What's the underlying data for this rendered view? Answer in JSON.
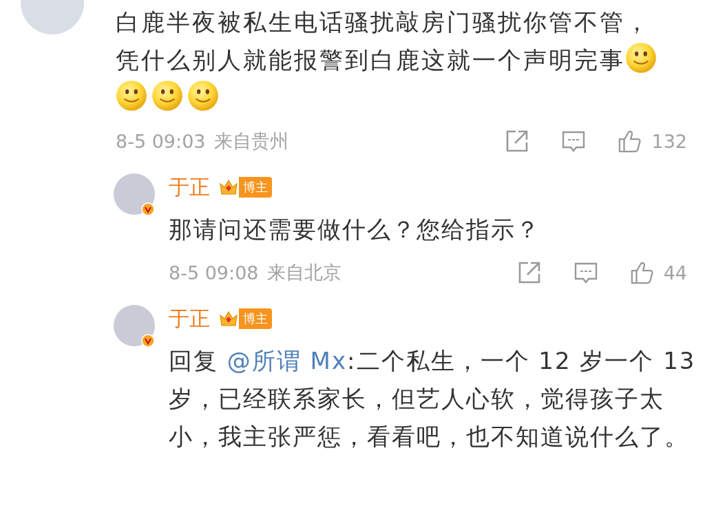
{
  "comments": [
    {
      "content": [
        {
          "kind": "text",
          "text": "白鹿半夜被私生电话骚扰敲房门骚扰你管不管，凭什么别人就能报警到白鹿这就一个声明完事"
        },
        {
          "kind": "emoji"
        },
        {
          "kind": "emoji"
        },
        {
          "kind": "emoji"
        },
        {
          "kind": "emoji"
        }
      ],
      "time": "8-5 09:03",
      "location": "来自贵州",
      "likes": "132"
    }
  ],
  "replies": [
    {
      "name": "于正",
      "badge": "博主",
      "verified": true,
      "content": [
        {
          "kind": "text",
          "text": "那请问还需要做什么？您给指示？"
        }
      ],
      "time": "8-5 09:08",
      "location": "来自北京",
      "likes": "44"
    },
    {
      "name": "于正",
      "badge": "博主",
      "verified": true,
      "content": [
        {
          "kind": "text",
          "text": "回复 "
        },
        {
          "kind": "mention",
          "text": "@所谓 Mx"
        },
        {
          "kind": "text",
          "text": ":二个私生，一个 12 岁一个 13 岁，已经联系家长，但艺人心软，觉得孩子太小，我主张严惩，看看吧，也不知道说什么了。"
        }
      ]
    }
  ]
}
